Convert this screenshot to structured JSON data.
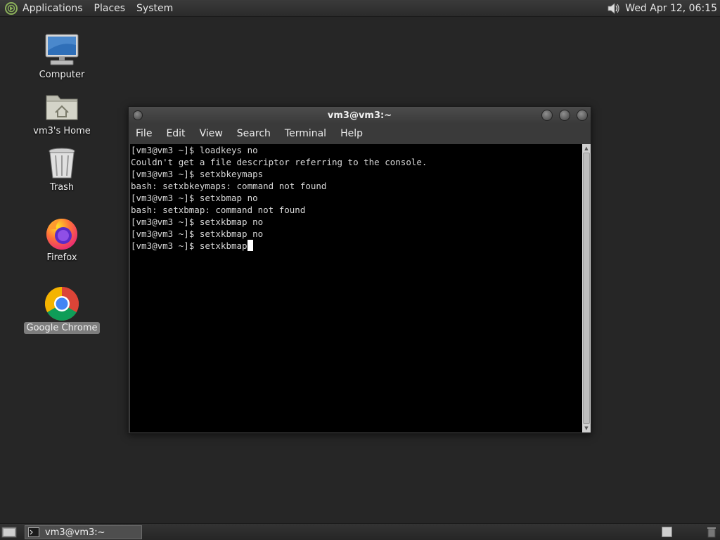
{
  "top_panel": {
    "menus": [
      "Applications",
      "Places",
      "System"
    ],
    "clock": "Wed Apr 12, 06:15"
  },
  "desktop_icons": [
    {
      "label": "Computer",
      "icon": "computer-icon"
    },
    {
      "label": "vm3's Home",
      "icon": "home-folder-icon"
    },
    {
      "label": "Trash",
      "icon": "trash-icon"
    },
    {
      "label": "Firefox",
      "icon": "firefox-icon"
    },
    {
      "label": "Google Chrome",
      "icon": "chrome-icon",
      "selected": true
    }
  ],
  "terminal": {
    "title": "vm3@vm3:~",
    "menus": [
      "File",
      "Edit",
      "View",
      "Search",
      "Terminal",
      "Help"
    ],
    "lines": [
      "[vm3@vm3 ~]$ loadkeys no",
      "Couldn't get a file descriptor referring to the console.",
      "[vm3@vm3 ~]$ setxbkeymaps",
      "bash: setxbkeymaps: command not found",
      "[vm3@vm3 ~]$ setxbmap no",
      "bash: setxbmap: command not found",
      "[vm3@vm3 ~]$ setxkbmap no",
      "[vm3@vm3 ~]$ setxkbmap no",
      "[vm3@vm3 ~]$ setxkbmap"
    ]
  },
  "taskbar": {
    "task_label": "vm3@vm3:~"
  },
  "colors": {
    "desktop": "#262626",
    "terminal_bg": "#000000",
    "terminal_fg": "#d8d8d8"
  }
}
